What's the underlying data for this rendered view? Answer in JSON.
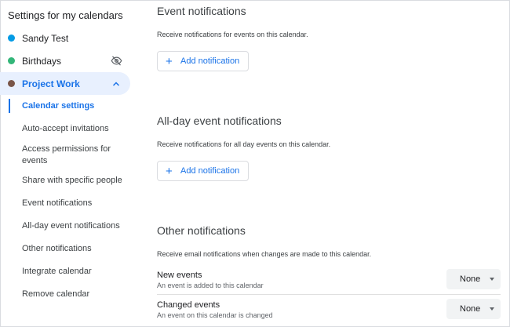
{
  "sidebar": {
    "heading": "Settings for my calendars",
    "calendars": [
      {
        "label": "Sandy Test",
        "color": "#039be5"
      },
      {
        "label": "Birthdays",
        "color": "#33b679",
        "icon": "visibility-off-icon"
      },
      {
        "label": "Project Work",
        "color": "#795548",
        "icon": "chevron-up-icon"
      }
    ],
    "subitems": [
      "Calendar settings",
      "Auto-accept invitations",
      "Access permissions for events",
      "Share with specific people",
      "Event notifications",
      "All-day event notifications",
      "Other notifications",
      "Integrate calendar",
      "Remove calendar"
    ]
  },
  "event_notifications": {
    "title": "Event notifications",
    "description": "Receive notifications for events on this calendar.",
    "add_label": "Add notification"
  },
  "allday_notifications": {
    "title": "All-day event notifications",
    "description": "Receive notifications for all day events on this calendar.",
    "add_label": "Add notification"
  },
  "other_notifications": {
    "title": "Other notifications",
    "description": "Receive email notifications when changes are made to this calendar.",
    "rows": [
      {
        "name": "New events",
        "sub": "An event is added to this calendar",
        "value": "None"
      },
      {
        "name": "Changed events",
        "sub": "An event on this calendar is changed",
        "value": "None"
      }
    ]
  },
  "colors": {
    "accent": "#1a73e8",
    "active_bg": "#e8f0fe"
  }
}
